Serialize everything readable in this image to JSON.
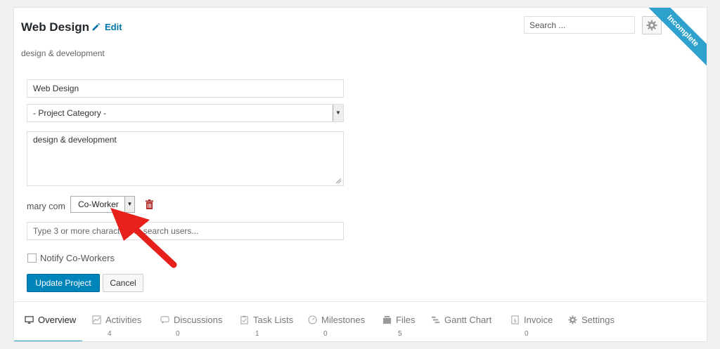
{
  "project": {
    "title": "Web Design",
    "edit_label": "Edit",
    "description": "design & development",
    "status_ribbon": "Incomplete"
  },
  "search": {
    "placeholder": "Search ..."
  },
  "form": {
    "name_value": "Web Design",
    "category_value": "- Project Category -",
    "description_value": "design & development",
    "member_name": "mary com",
    "member_role": "Co-Worker",
    "user_search_placeholder": "Type 3 or more characters to search users...",
    "notify_label": "Notify Co-Workers",
    "update_button": "Update Project",
    "cancel_button": "Cancel"
  },
  "tabs": [
    {
      "label": "Overview",
      "count": "",
      "icon": "monitor-icon"
    },
    {
      "label": "Activities",
      "count": "4",
      "icon": "chart-icon"
    },
    {
      "label": "Discussions",
      "count": "0",
      "icon": "chat-bubble-icon"
    },
    {
      "label": "Task Lists",
      "count": "1",
      "icon": "clipboard-icon"
    },
    {
      "label": "Milestones",
      "count": "0",
      "icon": "dashboard-icon"
    },
    {
      "label": "Files",
      "count": "5",
      "icon": "files-icon"
    },
    {
      "label": "Gantt Chart",
      "count": "",
      "icon": "gantt-icon"
    },
    {
      "label": "Invoice",
      "count": "0",
      "icon": "invoice-icon"
    },
    {
      "label": "Settings",
      "count": "",
      "icon": "gear-icon"
    }
  ],
  "colors": {
    "accent": "#0085ba",
    "ribbon": "#2ea2cc",
    "annotation_arrow": "#e8201c",
    "trash": "#b32d2e"
  }
}
